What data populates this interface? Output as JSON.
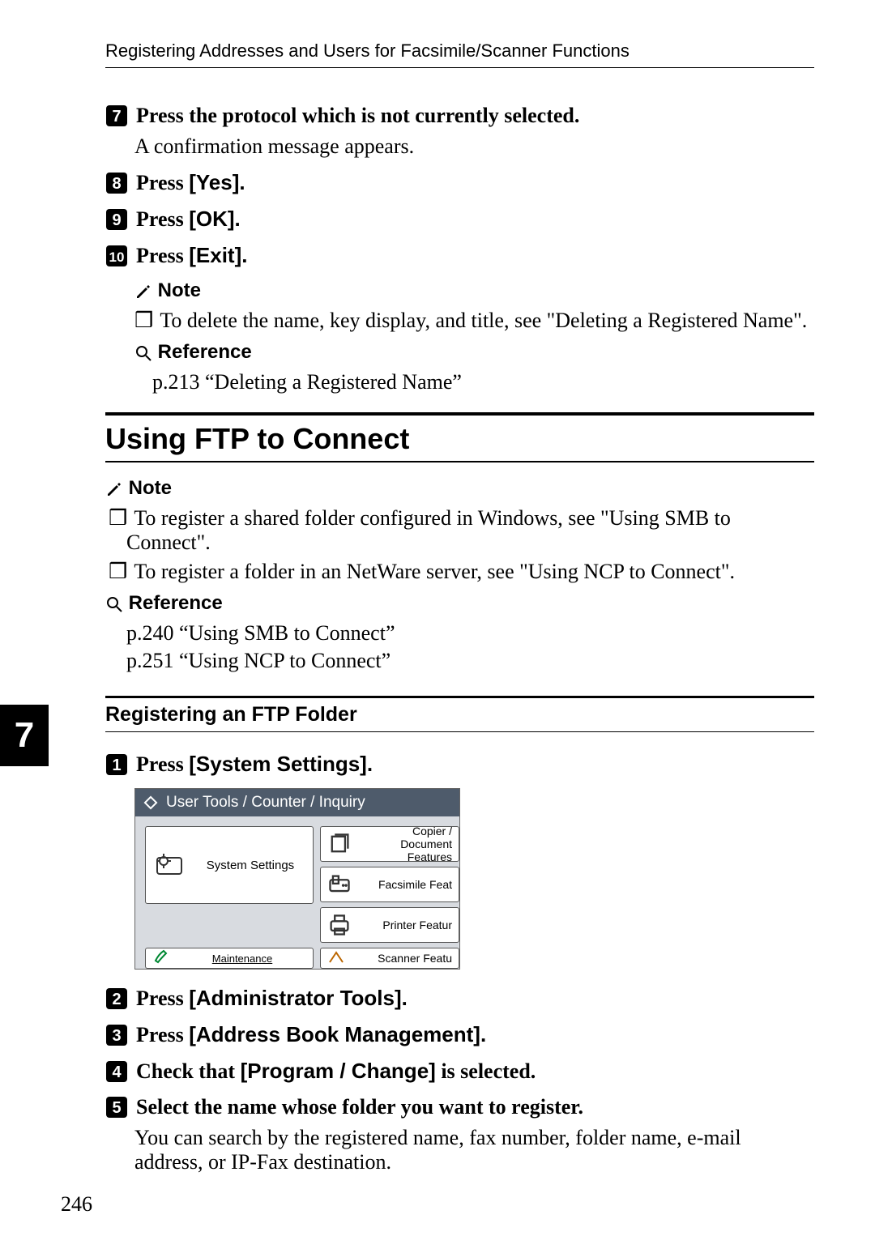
{
  "chapter": "7",
  "page_number": "246",
  "header": "Registering Addresses and Users for Facsimile/Scanner Functions",
  "steps_top": [
    {
      "n": "7",
      "text": "Press the protocol which is not currently selected.",
      "body": "A confirmation message appears."
    },
    {
      "n": "8",
      "text_pre": "Press ",
      "text_bold": "[Yes].",
      "text_post": ""
    },
    {
      "n": "9",
      "text_pre": "Press ",
      "text_bold": "[OK].",
      "text_post": ""
    },
    {
      "n": "10",
      "text_pre": "Press ",
      "text_bold": "[Exit].",
      "text_post": ""
    }
  ],
  "note1": {
    "heading": "Note",
    "items": [
      "To delete the name, key display, and title, see \"Deleting a Registered Name\"."
    ]
  },
  "ref1": {
    "heading": "Reference",
    "items": [
      "p.213 “Deleting a Registered Name”"
    ]
  },
  "h2": "Using FTP to Connect",
  "note2": {
    "heading": "Note",
    "items": [
      "To register a shared folder configured in Windows, see \"Using SMB to Connect\".",
      "To register a folder in an NetWare server, see \"Using NCP to Connect\"."
    ]
  },
  "ref2": {
    "heading": "Reference",
    "items": [
      "p.240 “Using SMB to Connect”",
      "p.251 “Using NCP to Connect”"
    ]
  },
  "h3": "Registering an FTP Folder",
  "steps_bottom": [
    {
      "n": "1",
      "text_pre": "Press ",
      "text_bold": "[System Settings].",
      "text_post": ""
    },
    {
      "n": "2",
      "text_pre": "Press ",
      "text_bold": "[Administrator Tools].",
      "text_post": ""
    },
    {
      "n": "3",
      "text_pre": "Press ",
      "text_bold": "[Address Book Management].",
      "text_post": ""
    },
    {
      "n": "4",
      "text_pre": "Check that ",
      "text_bold": "[Program / Change]",
      "text_post": " is selected."
    },
    {
      "n": "5",
      "text_pre": "Select the name whose folder you want to register.",
      "text_bold": "",
      "text_post": "",
      "body": "You can search by the registered name, fax number, folder name, e-mail address, or IP-Fax destination."
    }
  ],
  "ui": {
    "title": "User Tools / Counter / Inquiry",
    "system_settings": "System Settings",
    "maintenance": "Maintenance",
    "copier": "Copier / Document\nFeatures",
    "facsimile": "Facsimile Feat",
    "printer": "Printer Featur",
    "scanner": "Scanner Featu"
  }
}
